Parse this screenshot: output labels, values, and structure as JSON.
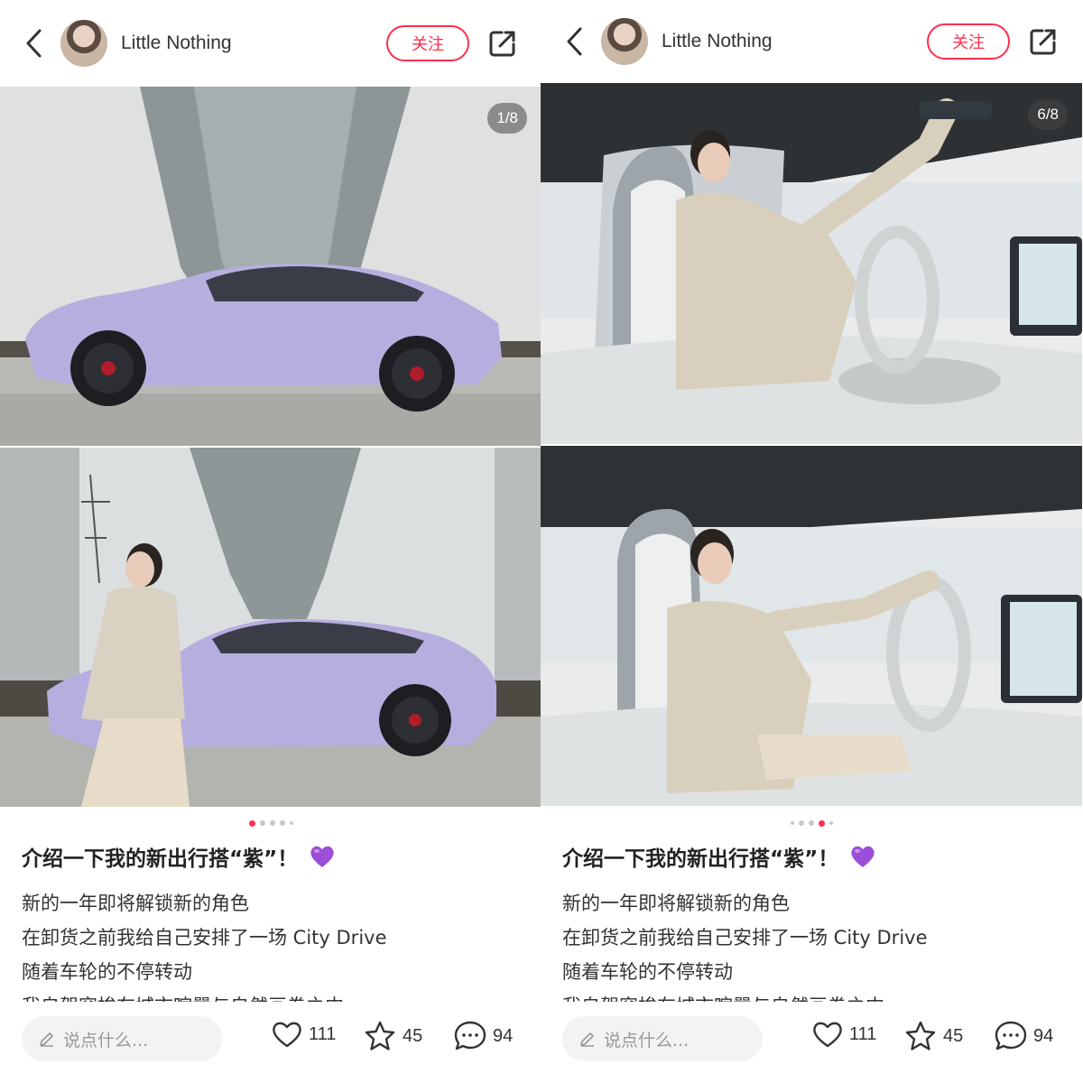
{
  "panels": [
    {
      "author": "Little Nothing",
      "follow_label": "关注",
      "counter": "1/8",
      "dots": 5,
      "active_dot": 0,
      "title": "介绍一下我的新出行搭“紫”！",
      "lines": [
        "新的一年即将解锁新的角色",
        "在卸货之前我给自己安排了一场 City Drive",
        "随着车轮的不停转动",
        "我自驾穿梭在城市喧嚣与自然画卷之中"
      ],
      "comment_placeholder": "说点什么...",
      "likes": "111",
      "favorites": "45",
      "comments": "94"
    },
    {
      "author": "Little Nothing",
      "follow_label": "关注",
      "counter": "6/8",
      "dots": 5,
      "active_dot": 3,
      "title": "介绍一下我的新出行搭“紫”！",
      "lines": [
        "新的一年即将解锁新的角色",
        "在卸货之前我给自己安排了一场 City Drive",
        "随着车轮的不停转动",
        "我自驾穿梭在城市喧嚣与自然画卷之中"
      ],
      "comment_placeholder": "说点什么...",
      "likes": "111",
      "favorites": "45",
      "comments": "94"
    }
  ],
  "icons": {
    "back": "chevron-left-icon",
    "share": "share-icon",
    "edit": "pencil-icon",
    "like": "heart-icon",
    "favorite": "star-icon",
    "comment": "chat-bubble-icon",
    "emoji": "purple-heart-icon"
  },
  "colors": {
    "accent": "#ff2e4d",
    "car": "#b7aee0",
    "emoji": "#9b4fd8"
  }
}
